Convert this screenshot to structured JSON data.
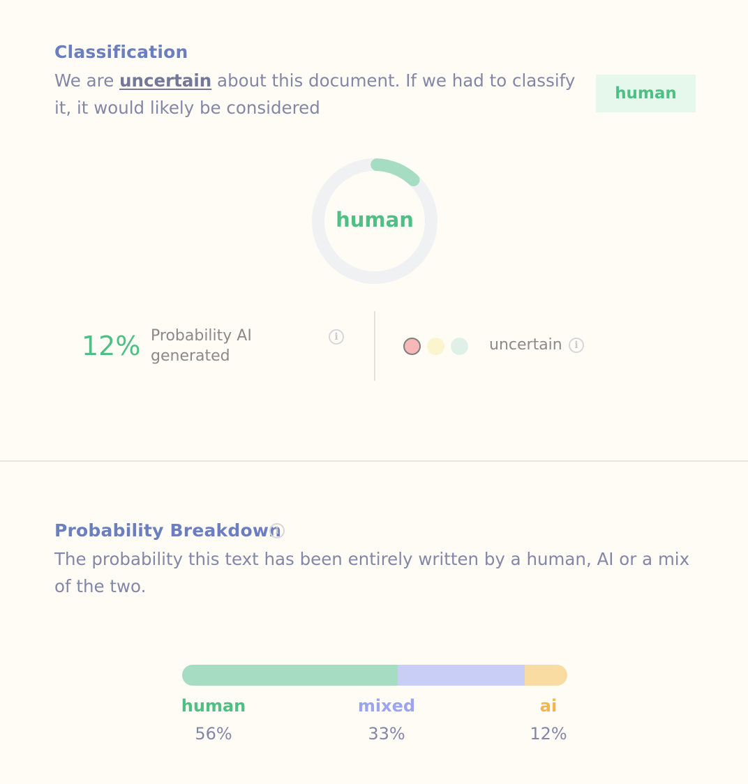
{
  "classification": {
    "title": "Classification",
    "sentence_prefix": "We are ",
    "certainty": "uncertain",
    "sentence_line1_rest": " about this document. If we had to classify",
    "sentence_line2": "it, it would likely be considered",
    "badge": "human"
  },
  "gauge": {
    "label": "human",
    "fraction": 0.12,
    "color": "#a6dcc2",
    "track_color": "#eff1f3"
  },
  "ai_probability": {
    "value": "12%",
    "label_line1": "Probability AI",
    "label_line2": "generated"
  },
  "confidence": {
    "label": "uncertain",
    "dots": [
      {
        "name": "low",
        "color": "#f7b9b7",
        "active": true
      },
      {
        "name": "medium",
        "color": "#fcf4cc",
        "active": false
      },
      {
        "name": "high",
        "color": "#dff1e7",
        "active": false
      }
    ]
  },
  "breakdown": {
    "title": "Probability Breakdown",
    "desc_line1": "The probability this text has been entirely written by a human, AI or a mix",
    "desc_line2": "of the two.",
    "segments": [
      {
        "label": "human",
        "pct": "56%",
        "fraction": 0.56,
        "color": "#a6dcc2",
        "text_color": "#4fbf86"
      },
      {
        "label": "mixed",
        "pct": "33%",
        "fraction": 0.33,
        "color": "#c9cef7",
        "text_color": "#9ba4ee"
      },
      {
        "label": "ai",
        "pct": "12%",
        "fraction": 0.11,
        "color": "#f8dca1",
        "text_color": "#f0b84b"
      }
    ]
  }
}
